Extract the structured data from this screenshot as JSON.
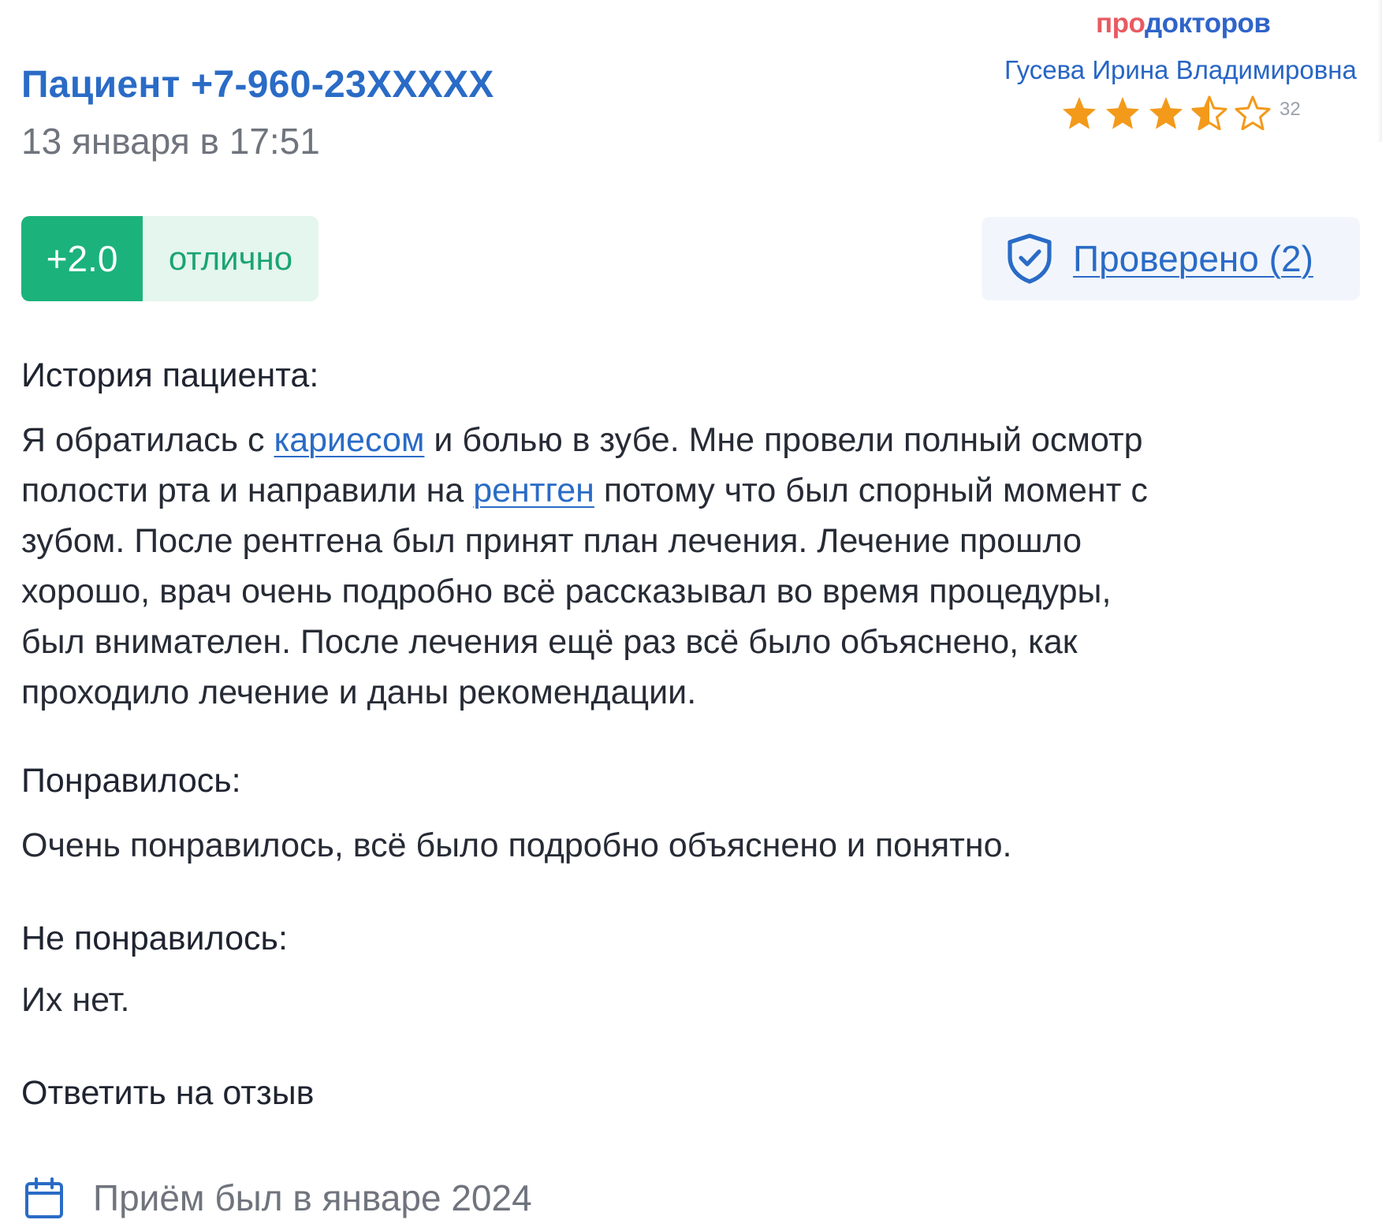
{
  "prodoctorov_card": {
    "brand_prefix": "про",
    "brand_rest": "докторов",
    "doctor_name": "Гусева Ирина Владимировна",
    "rating_stars": 3.5,
    "rating_max": 5,
    "reviews_count": "32",
    "colors": {
      "star": "#f39a1b",
      "brand_prefix": "#e85a62",
      "brand_rest": "#2f64c9"
    }
  },
  "review": {
    "author": "Пациент +7-960-23XXXXX",
    "date": "13 января в 17:51",
    "score": {
      "value": "+2.0",
      "label": "отлично",
      "colors": {
        "value_bg": "#1bb37b",
        "label_bg": "#e4f6ee",
        "label_text": "#1aa472"
      }
    },
    "verified": {
      "icon": "shield-check-icon",
      "label": "Проверено (2)"
    },
    "history": {
      "heading": "История пациента:",
      "line1_pre": "Я обратилась с ",
      "line1_link": "кариесом",
      "line1_post": " и болью в зубе. Мне провели полный осмотр",
      "line2_pre": "полости рта и направили на ",
      "line2_link": "рентген",
      "line2_post": " потому что был спорный момент с",
      "line3": "зубом. После рентгена был принят план лечения. Лечение прошло",
      "line4": "хорошо, врач очень подробно всё рассказывал во время процедуры,",
      "line5": "был внимателен. После лечения ещё раз всё было объяснено, как",
      "line6": "проходило лечение и даны рекомендации."
    },
    "liked": {
      "heading": "Понравилось:",
      "text": "Очень понравилось, всё было подробно объяснено и понятно."
    },
    "disliked": {
      "heading": "Не понравилось:",
      "text": "Их нет."
    },
    "reply_label": "Ответить на отзыв",
    "visit": {
      "icon": "calendar-icon",
      "text": "Приём был в январе 2024"
    }
  }
}
